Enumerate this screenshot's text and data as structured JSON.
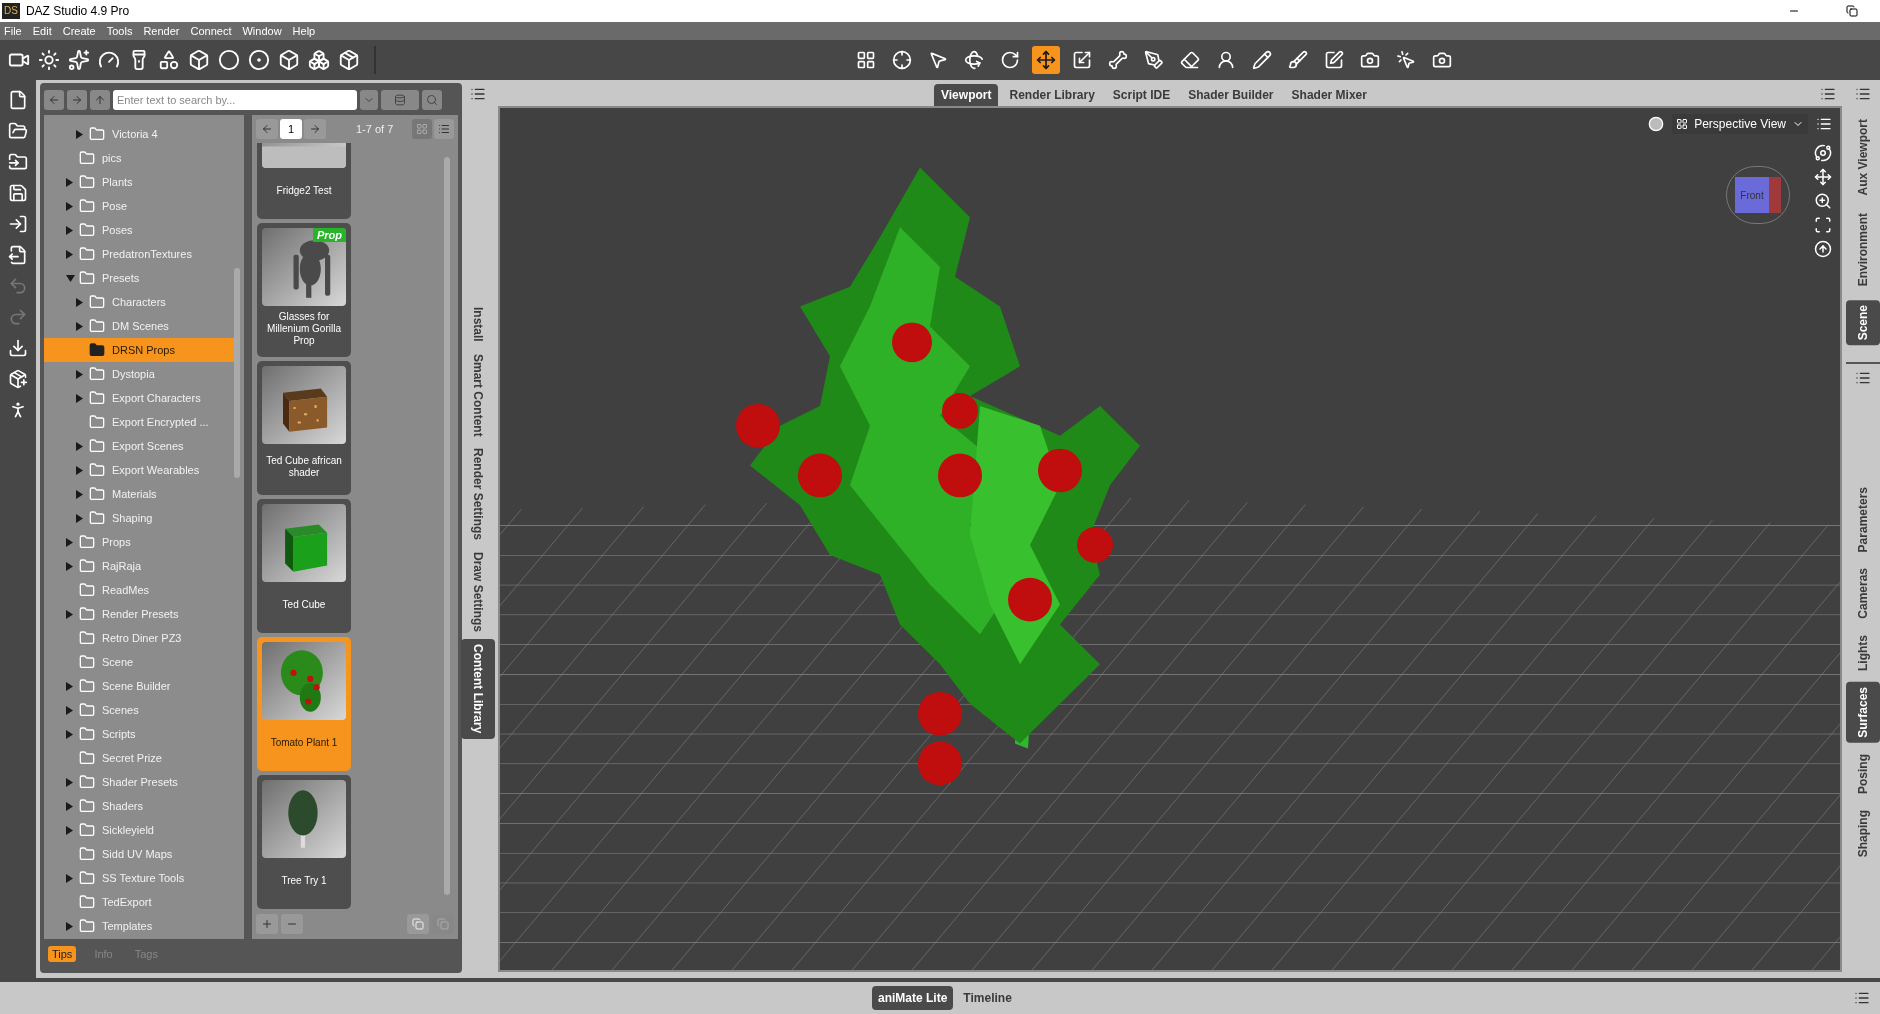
{
  "window": {
    "logo": "DS",
    "title": "DAZ Studio 4.9 Pro"
  },
  "menu": [
    "File",
    "Edit",
    "Create",
    "Tools",
    "Render",
    "Connect",
    "Window",
    "Help"
  ],
  "viewport_tools": [
    {
      "selected": false
    },
    {
      "selected": false
    },
    {
      "selected": false
    },
    {
      "selected": false
    },
    {
      "selected": false
    },
    {
      "selected": true
    },
    {
      "selected": false
    },
    {
      "selected": false
    },
    {
      "selected": false
    },
    {
      "selected": false
    },
    {
      "selected": false
    },
    {
      "selected": false
    },
    {
      "selected": false
    },
    {
      "selected": false
    },
    {
      "selected": false
    },
    {
      "selected": false
    },
    {
      "selected": false
    }
  ],
  "left_strip": [
    {
      "disabled": false
    },
    {
      "disabled": false
    },
    {
      "disabled": false
    },
    {
      "disabled": false
    },
    {
      "disabled": false
    },
    {
      "disabled": false
    },
    {
      "disabled": true
    },
    {
      "disabled": true
    },
    {
      "disabled": false
    },
    {
      "disabled": false
    },
    {
      "disabled": false
    }
  ],
  "content_library": {
    "search": {
      "placeholder": "Enter text to search by..."
    },
    "tree": {
      "continued_children": [
        {
          "label": "Victoria 4",
          "expanded": false,
          "selected": false
        }
      ],
      "items": [
        {
          "label": "pics",
          "selected": false
        },
        {
          "label": "Plants",
          "expanded": false,
          "selected": false
        },
        {
          "label": "Pose",
          "expanded": false,
          "selected": false
        },
        {
          "label": "Poses",
          "expanded": false,
          "selected": false
        },
        {
          "label": "PredatronTextures",
          "expanded": false,
          "selected": false
        },
        {
          "label": "Presets",
          "expanded": true,
          "selected": false,
          "children": [
            {
              "label": "Characters",
              "expanded": false,
              "selected": false
            },
            {
              "label": "DM Scenes",
              "expanded": false,
              "selected": false
            },
            {
              "label": "DRSN Props",
              "selected": true
            },
            {
              "label": "Dystopia",
              "expanded": false,
              "selected": false
            },
            {
              "label": "Export Characters",
              "expanded": false,
              "selected": false
            },
            {
              "label": "Export Encrypted ...",
              "selected": false
            },
            {
              "label": "Export Scenes",
              "expanded": false,
              "selected": false
            },
            {
              "label": "Export Wearables",
              "expanded": false,
              "selected": false
            },
            {
              "label": "Materials",
              "expanded": false,
              "selected": false
            },
            {
              "label": "Shaping",
              "expanded": false,
              "selected": false
            }
          ]
        },
        {
          "label": "Props",
          "expanded": false,
          "selected": false
        },
        {
          "label": "RajRaja",
          "expanded": false,
          "selected": false
        },
        {
          "label": "ReadMes",
          "selected": false
        },
        {
          "label": "Render Presets",
          "expanded": false,
          "selected": false
        },
        {
          "label": "Retro Diner PZ3",
          "selected": false
        },
        {
          "label": "Scene",
          "selected": false
        },
        {
          "label": "Scene Builder",
          "expanded": false,
          "selected": false
        },
        {
          "label": "Scenes",
          "expanded": false,
          "selected": false
        },
        {
          "label": "Scripts",
          "expanded": false,
          "selected": false
        },
        {
          "label": "Secret Prize",
          "selected": false
        },
        {
          "label": "Shader Presets",
          "expanded": false,
          "selected": false
        },
        {
          "label": "Shaders",
          "expanded": false,
          "selected": false
        },
        {
          "label": "Sickleyield",
          "expanded": false,
          "selected": false
        },
        {
          "label": "Sidd UV Maps",
          "selected": false
        },
        {
          "label": "SS Texture Tools",
          "expanded": false,
          "selected": false
        },
        {
          "label": "TedExport",
          "selected": false
        },
        {
          "label": "Templates",
          "expanded": false,
          "selected": false
        }
      ]
    },
    "pager": {
      "page": "1",
      "range": "1-7 of 7"
    },
    "cards": [
      {
        "label": "Fridge2 Test",
        "selected": false
      },
      {
        "label": "Glasses for Millenium Gorilla Prop",
        "badge": "Prop",
        "selected": false
      },
      {
        "label": "Ted Cube african shader",
        "selected": false
      },
      {
        "label": "Ted Cube",
        "selected": false
      },
      {
        "label": "Tomato Plant 1",
        "selected": true
      },
      {
        "label": "Tree Try 1",
        "selected": false
      }
    ],
    "bottom_tabs": [
      {
        "label": "Tips",
        "selected": true
      },
      {
        "label": "Info",
        "selected": false
      },
      {
        "label": "Tags",
        "selected": false
      }
    ]
  },
  "panel_tabs": [
    {
      "label": "Install",
      "selected": false
    },
    {
      "label": "Smart Content",
      "selected": false
    },
    {
      "label": "Render Settings",
      "selected": false
    },
    {
      "label": "Draw Settings",
      "selected": false
    },
    {
      "label": "Content Library",
      "selected": true
    }
  ],
  "viewport": {
    "tabs": [
      {
        "label": "Viewport",
        "selected": true
      },
      {
        "label": "Render Library",
        "selected": false
      },
      {
        "label": "Script IDE",
        "selected": false
      },
      {
        "label": "Shader Builder",
        "selected": false
      },
      {
        "label": "Shader Mixer",
        "selected": false
      }
    ],
    "camera": "Perspective View",
    "gizmo_face": "Front"
  },
  "right_tabs": {
    "upper": [
      {
        "label": "Aux Viewport",
        "selected": false
      },
      {
        "label": "Environment",
        "selected": false
      },
      {
        "label": "Scene",
        "selected": true
      }
    ],
    "lower": [
      {
        "label": "Parameters",
        "selected": false
      },
      {
        "label": "Cameras",
        "selected": false
      },
      {
        "label": "Lights",
        "selected": false
      },
      {
        "label": "Surfaces",
        "selected": true
      },
      {
        "label": "Posing",
        "selected": false
      },
      {
        "label": "Shaping",
        "selected": false
      }
    ]
  },
  "bottom_tabs": [
    {
      "label": "aniMate Lite",
      "selected": true
    },
    {
      "label": "Timeline",
      "selected": false
    }
  ]
}
